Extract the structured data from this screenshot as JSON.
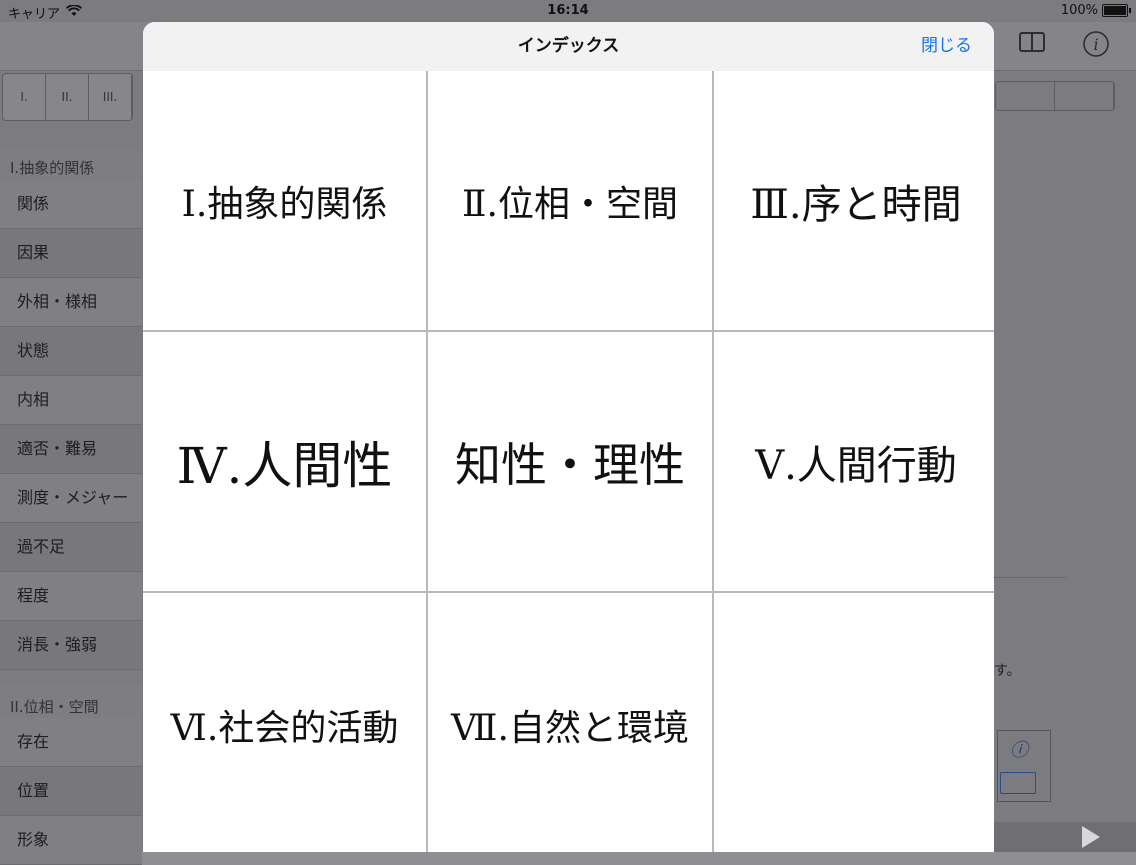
{
  "status_bar": {
    "carrier": "キャリア",
    "time": "16:14",
    "battery": "100%"
  },
  "background": {
    "segments": [
      "I.",
      "II.",
      "III."
    ],
    "sidebar": {
      "sections": [
        {
          "header": "I.抽象的関係",
          "items": [
            "関係",
            "因果",
            "外相・様相",
            "状態",
            "内相",
            "適否・難易",
            "測度・メジャー",
            "過不足",
            "程度",
            "消長・強弱"
          ]
        },
        {
          "header": "II.位相・空間",
          "items": [
            "存在",
            "位置",
            "形象"
          ]
        }
      ]
    },
    "right_note": "す。"
  },
  "modal": {
    "title": "インデックス",
    "close_label": "閉じる",
    "cells": [
      "Ⅰ.抽象的関係",
      "Ⅱ.位相・空間",
      "Ⅲ.序と時間",
      "Ⅳ.人間性",
      "知性・理性",
      "Ⅴ.人間行動",
      "Ⅵ.社会的活動",
      "Ⅶ.自然と環境",
      ""
    ]
  }
}
